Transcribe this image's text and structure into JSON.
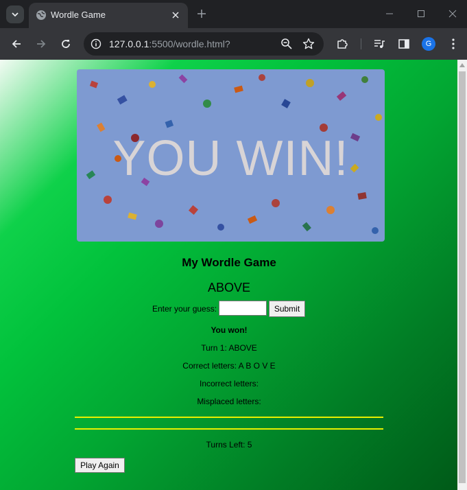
{
  "browser": {
    "tab_title": "Wordle Game",
    "url_host": "127.0.0.1",
    "url_path": ":5500/wordle.html?",
    "profile_initial": "G"
  },
  "banner": {
    "text": "YOU WIN!"
  },
  "game": {
    "title": "My Wordle Game",
    "target_word": "ABOVE",
    "guess_label": "Enter your guess:",
    "guess_value": "",
    "submit_label": "Submit",
    "result": "You won!",
    "turn_log": "Turn 1: ABOVE",
    "correct_letters": "Correct letters: A B O V E",
    "incorrect_letters": "Incorrect letters:",
    "misplaced_letters": "Misplaced letters:",
    "turns_left": "Turns Left: 5",
    "play_again_label": "Play Again"
  },
  "colors": {
    "accent_line": "#e8f000",
    "background_green": "#02a632"
  }
}
